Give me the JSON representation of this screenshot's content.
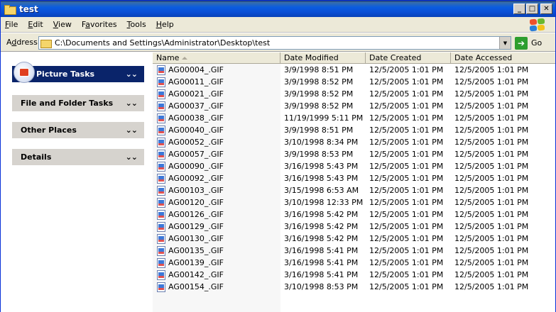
{
  "window": {
    "title": "test"
  },
  "menu": [
    {
      "underline": "F",
      "rest": "ile"
    },
    {
      "underline": "E",
      "rest": "dit"
    },
    {
      "underline": "V",
      "rest": "iew"
    },
    {
      "prefix": "F",
      "underline": "a",
      "rest": "vorites"
    },
    {
      "underline": "T",
      "rest": "ools"
    },
    {
      "underline": "H",
      "rest": "elp"
    }
  ],
  "address": {
    "label_underline": "d",
    "label_prefix": "A",
    "label_rest": "dress",
    "path": "C:\\Documents and Settings\\Administrator\\Desktop\\test",
    "go_label": "Go"
  },
  "tasks": [
    {
      "label": "Picture Tasks",
      "style": "blue"
    },
    {
      "label": "File and Folder Tasks",
      "style": "gray"
    },
    {
      "label": "Other Places",
      "style": "gray"
    },
    {
      "label": "Details",
      "style": "gray"
    }
  ],
  "columns": {
    "name": "Name",
    "modified": "Date Modified",
    "created": "Date Created",
    "accessed": "Date Accessed"
  },
  "files": [
    {
      "name": "AG00004_.GIF",
      "modified": "3/9/1998 8:51 PM",
      "created": "12/5/2005 1:01 PM",
      "accessed": "12/5/2005 1:01 PM"
    },
    {
      "name": "AG00011_.GIF",
      "modified": "3/9/1998 8:52 PM",
      "created": "12/5/2005 1:01 PM",
      "accessed": "12/5/2005 1:01 PM"
    },
    {
      "name": "AG00021_.GIF",
      "modified": "3/9/1998 8:52 PM",
      "created": "12/5/2005 1:01 PM",
      "accessed": "12/5/2005 1:01 PM"
    },
    {
      "name": "AG00037_.GIF",
      "modified": "3/9/1998 8:52 PM",
      "created": "12/5/2005 1:01 PM",
      "accessed": "12/5/2005 1:01 PM"
    },
    {
      "name": "AG00038_.GIF",
      "modified": "11/19/1999 5:11 PM",
      "created": "12/5/2005 1:01 PM",
      "accessed": "12/5/2005 1:01 PM"
    },
    {
      "name": "AG00040_.GIF",
      "modified": "3/9/1998 8:51 PM",
      "created": "12/5/2005 1:01 PM",
      "accessed": "12/5/2005 1:01 PM"
    },
    {
      "name": "AG00052_.GIF",
      "modified": "3/10/1998 8:34 PM",
      "created": "12/5/2005 1:01 PM",
      "accessed": "12/5/2005 1:01 PM"
    },
    {
      "name": "AG00057_.GIF",
      "modified": "3/9/1998 8:53 PM",
      "created": "12/5/2005 1:01 PM",
      "accessed": "12/5/2005 1:01 PM"
    },
    {
      "name": "AG00090_.GIF",
      "modified": "3/16/1998 5:43 PM",
      "created": "12/5/2005 1:01 PM",
      "accessed": "12/5/2005 1:01 PM"
    },
    {
      "name": "AG00092_.GIF",
      "modified": "3/16/1998 5:43 PM",
      "created": "12/5/2005 1:01 PM",
      "accessed": "12/5/2005 1:01 PM"
    },
    {
      "name": "AG00103_.GIF",
      "modified": "3/15/1998 6:53 AM",
      "created": "12/5/2005 1:01 PM",
      "accessed": "12/5/2005 1:01 PM"
    },
    {
      "name": "AG00120_.GIF",
      "modified": "3/10/1998 12:33 PM",
      "created": "12/5/2005 1:01 PM",
      "accessed": "12/5/2005 1:01 PM"
    },
    {
      "name": "AG00126_.GIF",
      "modified": "3/16/1998 5:42 PM",
      "created": "12/5/2005 1:01 PM",
      "accessed": "12/5/2005 1:01 PM"
    },
    {
      "name": "AG00129_.GIF",
      "modified": "3/16/1998 5:42 PM",
      "created": "12/5/2005 1:01 PM",
      "accessed": "12/5/2005 1:01 PM"
    },
    {
      "name": "AG00130_.GIF",
      "modified": "3/16/1998 5:42 PM",
      "created": "12/5/2005 1:01 PM",
      "accessed": "12/5/2005 1:01 PM"
    },
    {
      "name": "AG00135_.GIF",
      "modified": "3/16/1998 5:41 PM",
      "created": "12/5/2005 1:01 PM",
      "accessed": "12/5/2005 1:01 PM"
    },
    {
      "name": "AG00139_.GIF",
      "modified": "3/16/1998 5:41 PM",
      "created": "12/5/2005 1:01 PM",
      "accessed": "12/5/2005 1:01 PM"
    },
    {
      "name": "AG00142_.GIF",
      "modified": "3/16/1998 5:41 PM",
      "created": "12/5/2005 1:01 PM",
      "accessed": "12/5/2005 1:01 PM"
    },
    {
      "name": "AG00154_.GIF",
      "modified": "3/10/1998 8:53 PM",
      "created": "12/5/2005 1:01 PM",
      "accessed": "12/5/2005 1:01 PM"
    }
  ]
}
